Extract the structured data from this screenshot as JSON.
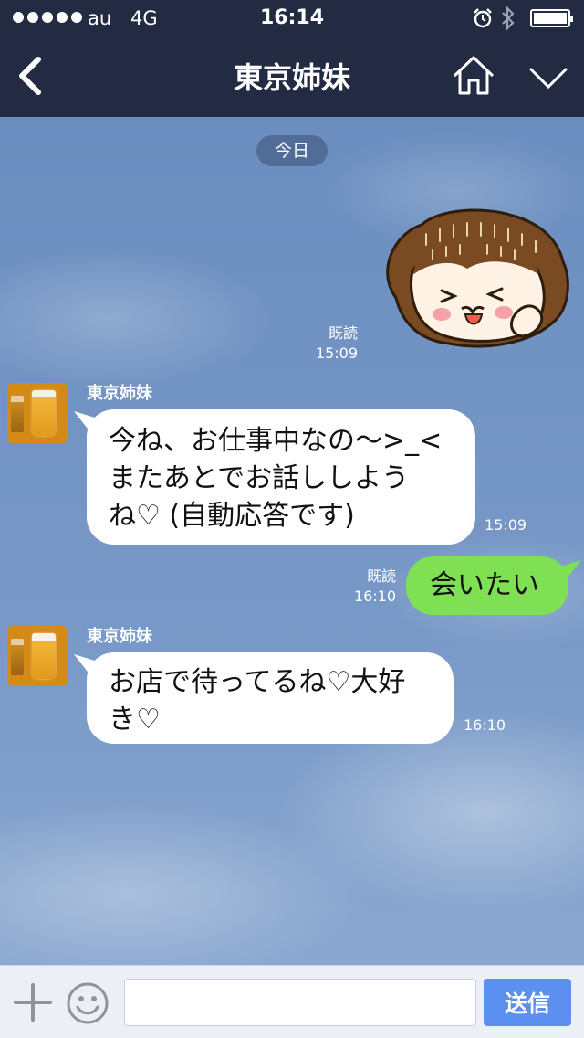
{
  "status_bar": {
    "carrier": "au",
    "network": "4G",
    "time": "16:14",
    "signal_icon": "signal-dots-icon",
    "alarm_icon": "alarm-icon",
    "bluetooth_icon": "bluetooth-icon",
    "battery_level": 1.0
  },
  "header": {
    "title": "東京姉妹",
    "back_icon": "chevron-left-icon",
    "home_icon": "home-icon",
    "menu_icon": "chevron-down-icon",
    "background_color": "#222b42"
  },
  "chat": {
    "date_label": "今日",
    "messages": [
      {
        "type": "sticker",
        "direction": "out",
        "read_label": "既読",
        "time": "15:09"
      },
      {
        "type": "text",
        "direction": "in",
        "sender": "東京姉妹",
        "text": "今ね、お仕事中なの〜>_<\nまたあとでお話ししよう\nね♡ (自動応答です)",
        "time": "15:09"
      },
      {
        "type": "text",
        "direction": "out",
        "read_label": "既読",
        "text": "会いたい",
        "time": "16:10"
      },
      {
        "type": "text",
        "direction": "in",
        "sender": "東京姉妹",
        "text": "お店で待ってるね♡大好\nき♡",
        "time": "16:10"
      }
    ]
  },
  "input_bar": {
    "plus_icon": "plus-icon",
    "emoji_icon": "smiley-icon",
    "placeholder": "",
    "value": "",
    "send_label": "送信",
    "send_color": "#5b8ff0"
  },
  "colors": {
    "outgoing_bubble": "#7fe053",
    "incoming_bubble": "#ffffff"
  }
}
